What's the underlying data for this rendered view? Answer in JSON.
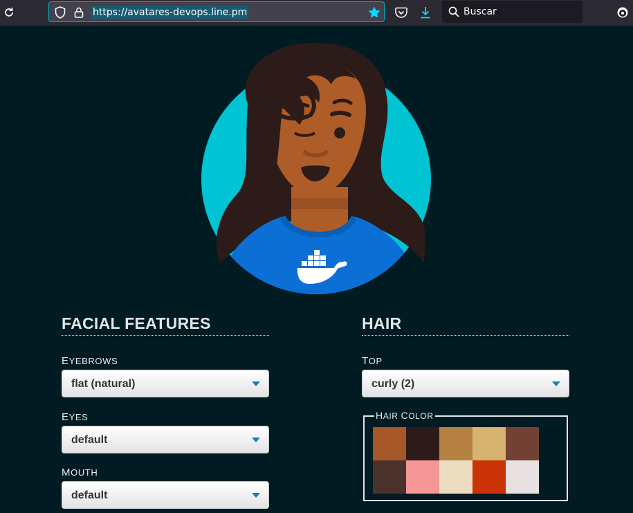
{
  "browser": {
    "url": "https://avatares-devops.line.pm",
    "search_placeholder": "Buscar",
    "bookmarked": true
  },
  "facial_features": {
    "title": "FACIAL FEATURES",
    "fields": [
      {
        "label_first": "E",
        "label_rest": "YEBROWS",
        "value": "flat (natural)"
      },
      {
        "label_first": "E",
        "label_rest": "YES",
        "value": "default"
      },
      {
        "label_first": "M",
        "label_rest": "OUTH",
        "value": "default"
      }
    ]
  },
  "hair": {
    "title": "HAIR",
    "top": {
      "label_first": "T",
      "label_rest": "OP",
      "value": "curly (2)"
    },
    "color_legend_first": "H",
    "color_legend_rest": "AIR ",
    "color_legend_first2": "C",
    "color_legend_rest2": "OLOR",
    "swatches": [
      "#a55728",
      "#2c1b18",
      "#b58143",
      "#d6b370",
      "#724133",
      "#4a312c",
      "#f59797",
      "#ecdcbf",
      "#c93305",
      "#e8e1e1"
    ]
  },
  "colors": {
    "accent": "#00b3c5",
    "background": "#001b22",
    "avatar_bg": "#00c3d3",
    "shirt": "#0b6fd6",
    "skin": "#ae5d29"
  }
}
